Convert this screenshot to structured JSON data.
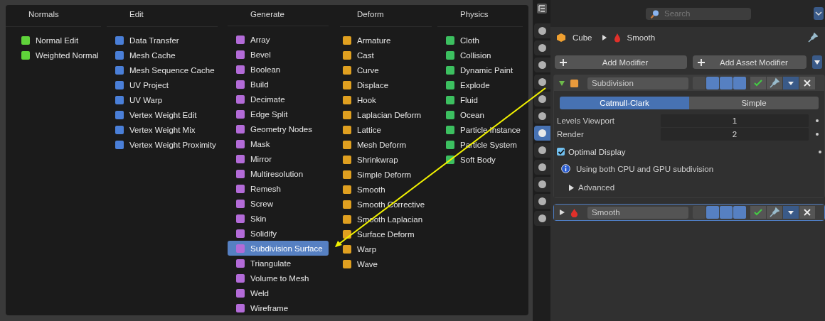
{
  "menu": {
    "columns": [
      {
        "title": "Normals",
        "kind": "normals",
        "items": [
          {
            "label": "Normal Edit",
            "selected": false
          },
          {
            "label": "Weighted Normal",
            "selected": false
          }
        ]
      },
      {
        "title": "Edit",
        "kind": "edit",
        "items": [
          {
            "label": "Data Transfer",
            "selected": false
          },
          {
            "label": "Mesh Cache",
            "selected": false
          },
          {
            "label": "Mesh Sequence Cache",
            "selected": false
          },
          {
            "label": "UV Project",
            "selected": false
          },
          {
            "label": "UV Warp",
            "selected": false
          },
          {
            "label": "Vertex Weight Edit",
            "selected": false
          },
          {
            "label": "Vertex Weight Mix",
            "selected": false
          },
          {
            "label": "Vertex Weight Proximity",
            "selected": false
          }
        ]
      },
      {
        "title": "Generate",
        "kind": "generate",
        "items": [
          {
            "label": "Array",
            "selected": false
          },
          {
            "label": "Bevel",
            "selected": false
          },
          {
            "label": "Boolean",
            "selected": false
          },
          {
            "label": "Build",
            "selected": false
          },
          {
            "label": "Decimate",
            "selected": false
          },
          {
            "label": "Edge Split",
            "selected": false
          },
          {
            "label": "Geometry Nodes",
            "selected": false
          },
          {
            "label": "Mask",
            "selected": false
          },
          {
            "label": "Mirror",
            "selected": false
          },
          {
            "label": "Multiresolution",
            "selected": false
          },
          {
            "label": "Remesh",
            "selected": false
          },
          {
            "label": "Screw",
            "selected": false
          },
          {
            "label": "Skin",
            "selected": false
          },
          {
            "label": "Solidify",
            "selected": false
          },
          {
            "label": "Subdivision Surface",
            "selected": true
          },
          {
            "label": "Triangulate",
            "selected": false
          },
          {
            "label": "Volume to Mesh",
            "selected": false
          },
          {
            "label": "Weld",
            "selected": false
          },
          {
            "label": "Wireframe",
            "selected": false
          }
        ]
      },
      {
        "title": "Deform",
        "kind": "deform",
        "items": [
          {
            "label": "Armature",
            "selected": false
          },
          {
            "label": "Cast",
            "selected": false
          },
          {
            "label": "Curve",
            "selected": false
          },
          {
            "label": "Displace",
            "selected": false
          },
          {
            "label": "Hook",
            "selected": false
          },
          {
            "label": "Laplacian Deform",
            "selected": false
          },
          {
            "label": "Lattice",
            "selected": false
          },
          {
            "label": "Mesh Deform",
            "selected": false
          },
          {
            "label": "Shrinkwrap",
            "selected": false
          },
          {
            "label": "Simple Deform",
            "selected": false
          },
          {
            "label": "Smooth",
            "selected": false
          },
          {
            "label": "Smooth Corrective",
            "selected": false
          },
          {
            "label": "Smooth Laplacian",
            "selected": false
          },
          {
            "label": "Surface Deform",
            "selected": false
          },
          {
            "label": "Warp",
            "selected": false
          },
          {
            "label": "Wave",
            "selected": false
          }
        ]
      },
      {
        "title": "Physics",
        "kind": "physics",
        "items": [
          {
            "label": "Cloth",
            "selected": false
          },
          {
            "label": "Collision",
            "selected": false
          },
          {
            "label": "Dynamic Paint",
            "selected": false
          },
          {
            "label": "Explode",
            "selected": false
          },
          {
            "label": "Fluid",
            "selected": false
          },
          {
            "label": "Ocean",
            "selected": false
          },
          {
            "label": "Particle Instance",
            "selected": false
          },
          {
            "label": "Particle System",
            "selected": false
          },
          {
            "label": "Soft Body",
            "selected": false
          }
        ]
      }
    ]
  },
  "property_tabs": [
    {
      "selected": false
    },
    {
      "selected": false
    },
    {
      "selected": false
    },
    {
      "selected": false
    },
    {
      "selected": false
    },
    {
      "selected": false
    },
    {
      "selected": true
    },
    {
      "selected": false
    },
    {
      "selected": false
    },
    {
      "selected": false
    },
    {
      "selected": false
    },
    {
      "selected": false
    }
  ],
  "properties": {
    "search": {
      "placeholder": "Search"
    },
    "breadcrumb": {
      "object": "Cube",
      "modifier": "Smooth"
    },
    "buttons": [
      "Add Modifier",
      "Add Asset Modifier"
    ],
    "modifiers": [
      {
        "name": "Subdivision",
        "kind": "subdivision",
        "expanded": true,
        "selected": false,
        "tabs": [
          {
            "label": "Catmull-Clark",
            "selected": true
          },
          {
            "label": "Simple",
            "selected": false
          }
        ],
        "fields": [
          {
            "label": "Levels Viewport",
            "value": "1"
          },
          {
            "label": "Render",
            "value": "2"
          }
        ],
        "checkbox": {
          "label": "Optimal Display",
          "checked": true
        },
        "info": "Using both CPU and GPU subdivision",
        "subpanel": {
          "label": "Advanced",
          "expanded": false
        }
      },
      {
        "name": "Smooth",
        "kind": "smooth",
        "expanded": false,
        "selected": true
      }
    ]
  }
}
